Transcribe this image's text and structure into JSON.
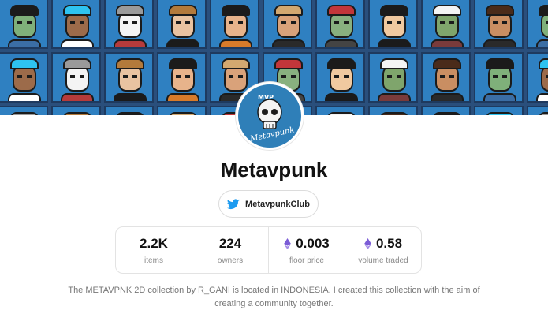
{
  "collection": {
    "name": "Metavpunk",
    "twitter_handle": "MetavpunkClub",
    "description": "The METAVPNK 2D collection by R_GANI is located in INDONESIA. I created this collection with the aim of creating a community together.",
    "avatar_logo_text": "MVP",
    "avatar_script_text": "Metavpunk"
  },
  "stats": [
    {
      "value": "2.2K",
      "label": "items",
      "eth": false
    },
    {
      "value": "224",
      "label": "owners",
      "eth": false
    },
    {
      "value": "0.003",
      "label": "floor price",
      "eth": true
    },
    {
      "value": "0.58",
      "label": "volume traded",
      "eth": true
    }
  ],
  "colors": {
    "banner_tile_bg": "#2f80c1",
    "twitter_blue": "#1d9bf0",
    "eth_purple": "#7b5cd6"
  },
  "icons": {
    "twitter": "twitter-icon",
    "eth": "ethereum-icon"
  }
}
